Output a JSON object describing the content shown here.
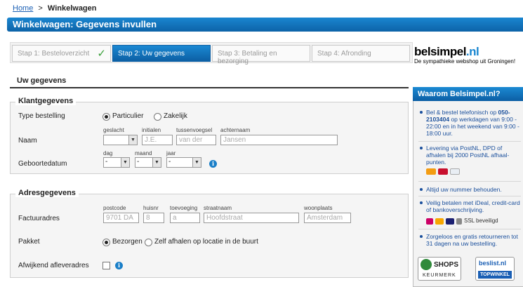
{
  "breadcrumb": {
    "home": "Home",
    "separator": ">",
    "current": "Winkelwagen"
  },
  "page_title": "Winkelwagen: Gegevens invullen",
  "steps": [
    {
      "label": "Stap 1: Besteloverzicht",
      "state": "done"
    },
    {
      "label": "Stap 2: Uw gegevens",
      "state": "active"
    },
    {
      "label": "Stap 3: Betaling en bezorging",
      "state": "todo"
    },
    {
      "label": "Stap 4: Afronding",
      "state": "todo"
    }
  ],
  "logo": {
    "name_a": "belsimpel",
    "name_b": ".nl",
    "tagline": "De sympathieke webshop uit Groningen!"
  },
  "section_title": "Uw gegevens",
  "klant": {
    "legend": "Klantgegevens",
    "type_label": "Type bestelling",
    "type_options": [
      "Particulier",
      "Zakelijk"
    ],
    "type_selected": "Particulier",
    "naam_label": "Naam",
    "naam_sublabels": {
      "geslacht": "geslacht",
      "initialen": "initialen",
      "tussenvoegsel": "tussenvoegsel",
      "achternaam": "achternaam"
    },
    "naam_placeholders": {
      "initialen": "J.E.",
      "tussenvoegsel": "van der",
      "achternaam": "Jansen"
    },
    "geboorte_label": "Geboortedatum",
    "geboorte_sublabels": {
      "dag": "dag",
      "maand": "maand",
      "jaar": "jaar"
    },
    "geboorte_values": {
      "dag": "-",
      "maand": "-",
      "jaar": "-"
    }
  },
  "adres": {
    "legend": "Adresgegevens",
    "factuur_label": "Factuuradres",
    "sublabels": {
      "postcode": "postcode",
      "huisnr": "huisnr",
      "toevoeging": "toevoeging",
      "straatnaam": "straatnaam",
      "woonplaats": "woonplaats"
    },
    "placeholders": {
      "postcode": "9701 DA",
      "huisnr": "8",
      "toevoeging": "a",
      "straatnaam": "Hoofdstraat",
      "woonplaats": "Amsterdam"
    },
    "pakket_label": "Pakket",
    "pakket_options": [
      "Bezorgen",
      "Zelf afhalen op locatie in de buurt"
    ],
    "pakket_selected": "Bezorgen",
    "afwijkend_label": "Afwijkend afleveradres"
  },
  "sidebar": {
    "title": "Waarom Belsimpel.nl?",
    "items": [
      {
        "pre": "Bel & bestel telefonisch op ",
        "strong": "050-2103404",
        "post": " op werkdagen van 9:00 - 22:00 en in het weekend van 9:00 - 18:00 uur."
      },
      {
        "text": "Levering via PostNL, DPD of afhalen bij 2000 PostNL afhaal-punten."
      },
      {
        "text": "Altijd uw nummer behouden."
      },
      {
        "text": "Veilig betalen met iDeal, credit-card of bankoverschrijving."
      },
      {
        "text": "Zorgeloos en gratis retourneren tot 31 dagen na uw bestelling."
      }
    ],
    "ssl_text": "SSL beveiligd",
    "badges": {
      "qshops_name": "SHOPS",
      "qshops_sub": "KEURMERK",
      "beslist_name": "beslist.nl",
      "beslist_sub": "TOPWINKEL"
    }
  },
  "colors": {
    "accent": "#0e6bb0",
    "link": "#1a5fb4",
    "check": "#3aa03a"
  }
}
